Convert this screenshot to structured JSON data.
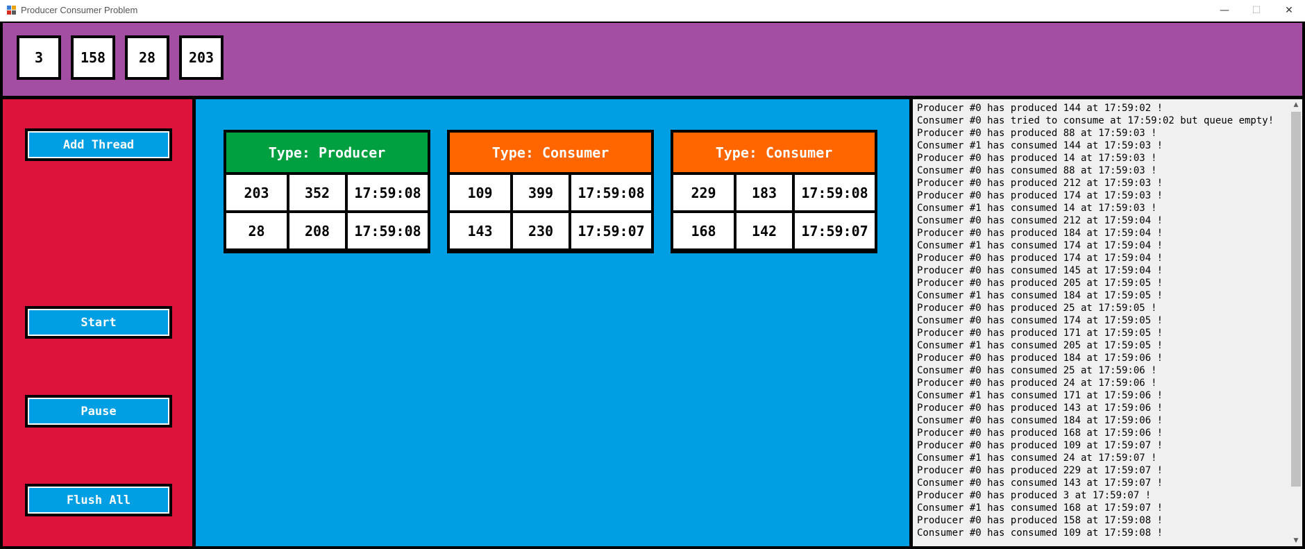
{
  "window": {
    "title": "Producer Consumer Problem",
    "minimize_glyph": "—",
    "maximize_glyph": "☐",
    "close_glyph": "✕"
  },
  "queue": [
    "3",
    "158",
    "28",
    "203"
  ],
  "controls": {
    "add_thread": "Add Thread",
    "start": "Start",
    "pause": "Pause",
    "flush_all": "Flush All"
  },
  "threads": [
    {
      "type_label": "Type: Producer",
      "color": "#00A040",
      "rows": [
        [
          "203",
          "352",
          "17:59:08"
        ],
        [
          "28",
          "208",
          "17:59:08"
        ]
      ]
    },
    {
      "type_label": "Type: Consumer",
      "color": "#FF6600",
      "rows": [
        [
          "109",
          "399",
          "17:59:08"
        ],
        [
          "143",
          "230",
          "17:59:07"
        ]
      ]
    },
    {
      "type_label": "Type: Consumer",
      "color": "#FF6600",
      "rows": [
        [
          "229",
          "183",
          "17:59:08"
        ],
        [
          "168",
          "142",
          "17:59:07"
        ]
      ]
    }
  ],
  "colors": {
    "top_panel": "#A34DA3",
    "left_panel": "#DC143C",
    "center_panel": "#009FE3",
    "button": "#009FE3",
    "producer": "#00A040",
    "consumer": "#FF6600"
  },
  "log": [
    "Producer #0 has produced 144 at 17:59:02 !",
    "Consumer #0 has tried to consume at 17:59:02 but queue empty!",
    "Producer #0 has produced 88 at 17:59:03 !",
    "Consumer #1 has consumed 144 at 17:59:03 !",
    "Producer #0 has produced 14 at 17:59:03 !",
    "Consumer #0 has consumed 88 at 17:59:03 !",
    "Producer #0 has produced 212 at 17:59:03 !",
    "Producer #0 has produced 174 at 17:59:03 !",
    "Consumer #1 has consumed 14 at 17:59:03 !",
    "Consumer #0 has consumed 212 at 17:59:04 !",
    "Producer #0 has produced 184 at 17:59:04 !",
    "Consumer #1 has consumed 174 at 17:59:04 !",
    "Producer #0 has produced 174 at 17:59:04 !",
    "Producer #0 has consumed 145 at 17:59:04 !",
    "Producer #0 has produced 205 at 17:59:05 !",
    "Consumer #1 has consumed 184 at 17:59:05 !",
    "Producer #0 has produced 25 at 17:59:05 !",
    "Consumer #0 has consumed 174 at 17:59:05 !",
    "Producer #0 has produced 171 at 17:59:05 !",
    "Consumer #1 has consumed 205 at 17:59:05 !",
    "Producer #0 has produced 184 at 17:59:06 !",
    "Consumer #0 has consumed 25 at 17:59:06 !",
    "Producer #0 has produced 24 at 17:59:06 !",
    "Consumer #1 has consumed 171 at 17:59:06 !",
    "Producer #0 has produced 143 at 17:59:06 !",
    "Consumer #0 has consumed 184 at 17:59:06 !",
    "Producer #0 has produced 168 at 17:59:06 !",
    "Producer #0 has produced 109 at 17:59:07 !",
    "Consumer #1 has consumed 24 at 17:59:07 !",
    "Producer #0 has produced 229 at 17:59:07 !",
    "Consumer #0 has consumed 143 at 17:59:07 !",
    "Producer #0 has produced 3 at 17:59:07 !",
    "Consumer #1 has consumed 168 at 17:59:07 !",
    "Producer #0 has produced 158 at 17:59:08 !",
    "Consumer #0 has consumed 109 at 17:59:08 !"
  ]
}
